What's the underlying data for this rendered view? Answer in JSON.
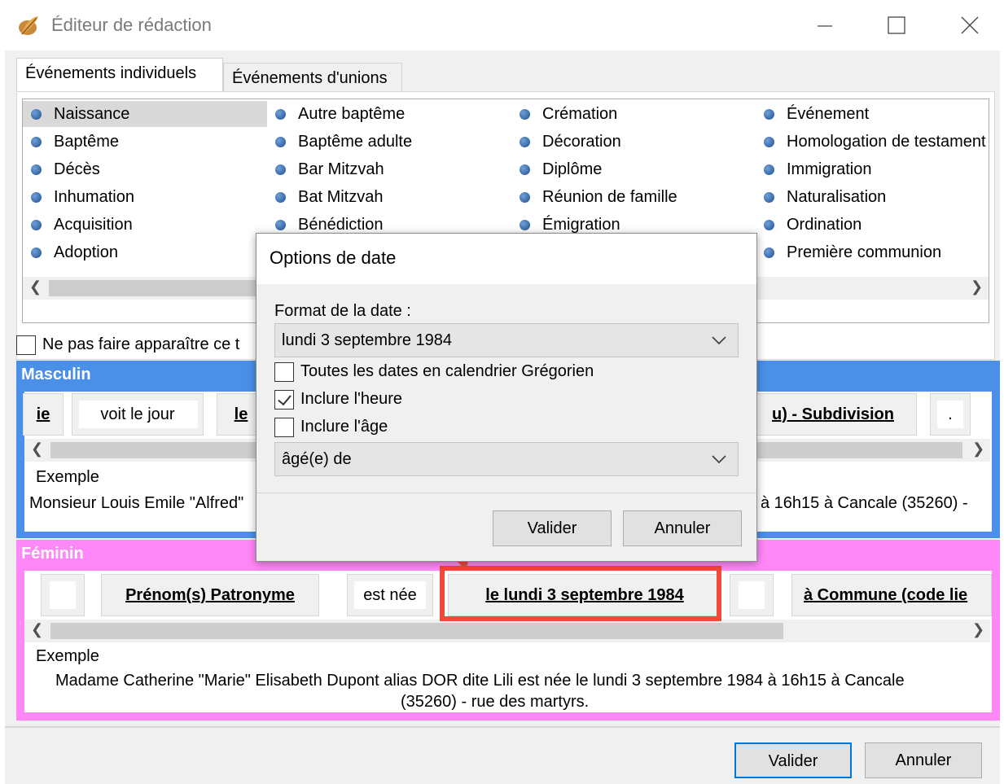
{
  "window": {
    "title": "Éditeur de rédaction"
  },
  "tabs": [
    {
      "label": "Événements individuels",
      "active": true
    },
    {
      "label": "Événements d'unions",
      "active": false
    }
  ],
  "events": {
    "columns": [
      [
        "Naissance",
        "Baptême",
        "Décès",
        "Inhumation",
        "Acquisition",
        "Adoption"
      ],
      [
        "Autre baptême",
        "Baptême adulte",
        "Bar Mitzvah",
        "Bat Mitzvah",
        "Bénédiction",
        ""
      ],
      [
        "Crémation",
        "Décoration",
        "Diplôme",
        "Réunion de famille",
        "Émigration",
        ""
      ],
      [
        "Événement",
        "Homologation de testament",
        "Immigration",
        "Naturalisation",
        "Ordination",
        "Première communion"
      ]
    ],
    "selected": "Naissance"
  },
  "hide_checkbox_label": "Ne pas faire apparaître ce t",
  "masculin": {
    "title": "Masculin",
    "tokens": [
      "ie",
      "voit le jour",
      "le",
      "u) - Subdivision",
      "."
    ],
    "example_label": "Exemple",
    "example_left": "Monsieur Louis Emile \"Alfred\"",
    "example_right": "à 16h15 à Cancale (35260) -"
  },
  "feminin": {
    "title": "Féminin",
    "tokens": [
      "Prénom(s) Patronyme",
      "est née",
      "le lundi 3 septembre 1984",
      "à Commune (code lie"
    ],
    "example_label": "Exemple",
    "example_line1": "Madame Catherine \"Marie\" Elisabeth Dupont alias DOR dite Lili est née le lundi 3 septembre 1984 à 16h15 à Cancale",
    "example_line2": "(35260) - rue des martyrs."
  },
  "footer": {
    "ok": "Valider",
    "cancel": "Annuler"
  },
  "modal": {
    "title": "Options de date",
    "format_label": "Format de la date :",
    "format_value": "lundi 3 septembre 1984",
    "opt_gregorian": "Toutes les dates en calendrier Grégorien",
    "opt_gregorian_checked": false,
    "opt_time": "Inclure l'heure",
    "opt_time_checked": true,
    "opt_age": "Inclure l'âge",
    "opt_age_checked": false,
    "age_value": "âgé(e) de",
    "ok": "Valider",
    "cancel": "Annuler"
  },
  "colors": {
    "masculin": "#4a90e8",
    "feminin": "#ff88f8",
    "highlight": "#f04a3a",
    "bullet": "#2d64a8"
  }
}
